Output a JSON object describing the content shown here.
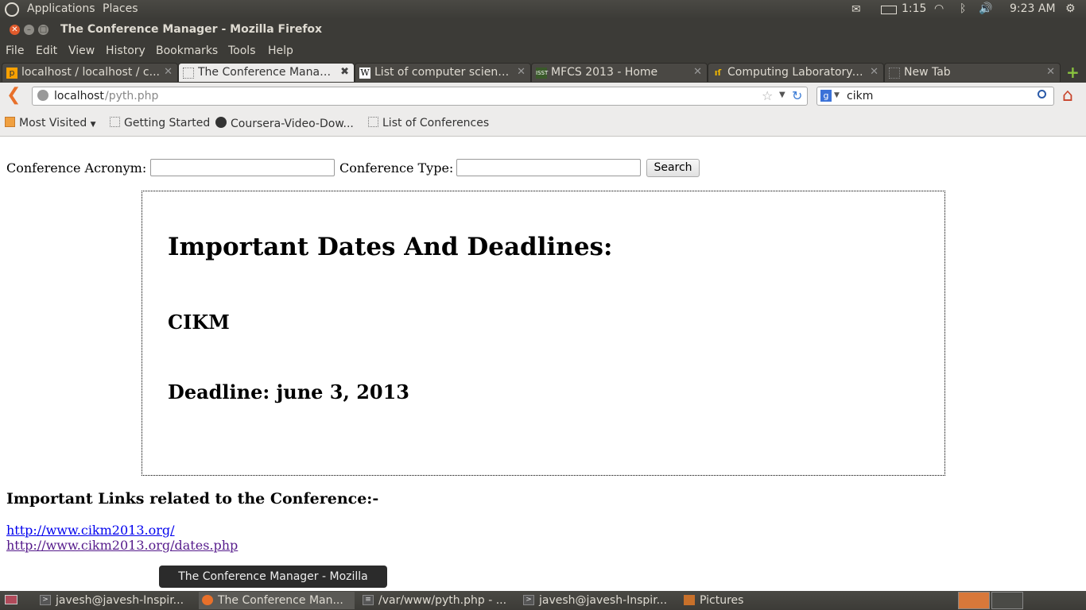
{
  "top_panel": {
    "menus": [
      "Applications",
      "Places"
    ],
    "battery": "1:15",
    "clock": "9:23 AM"
  },
  "window": {
    "title": "The Conference Manager - Mozilla Firefox"
  },
  "menu_bar": [
    "File",
    "Edit",
    "View",
    "History",
    "Bookmarks",
    "Tools",
    "Help"
  ],
  "tabs": [
    {
      "label": "localhost / localhost / c...",
      "icon": "pma-icon"
    },
    {
      "label": "The Conference Manager",
      "icon": "blank-page-icon",
      "active": true
    },
    {
      "label": "List of computer scienc...",
      "icon": "wikipedia-icon"
    },
    {
      "label": "MFCS 2013 - Home",
      "icon": "isst-icon"
    },
    {
      "label": "Computing Laboratory:...",
      "icon": "oxford-icon"
    },
    {
      "label": "New Tab",
      "icon": "blank-page-icon"
    }
  ],
  "nav": {
    "url_host": "localhost",
    "url_path": "/pyth.php",
    "search_query": "cikm"
  },
  "bookmarks": [
    "Most Visited",
    "Getting Started",
    "Coursera-Video-Dow...",
    "List of Conferences"
  ],
  "page": {
    "acronym_label": "Conference Acronym:",
    "type_label": "Conference Type:",
    "search_button": "Search",
    "dates_heading": "Important Dates And Deadlines:",
    "conference": "CIKM",
    "deadline": "Deadline: june 3, 2013",
    "links_heading": "Important Links related to the Conference:-",
    "links": [
      "http://www.cikm2013.org/",
      "http://www.cikm2013.org/dates.php"
    ],
    "link_colors": [
      "#0000ee",
      "#551a8b"
    ]
  },
  "tooltip": "The Conference Manager - Mozilla Firefox",
  "taskbar": [
    {
      "label": "javesh@javesh-Inspir...",
      "icon": "terminal-icon"
    },
    {
      "label": "The Conference Man...",
      "icon": "firefox-icon",
      "active": true
    },
    {
      "label": "/var/www/pyth.php - ...",
      "icon": "text-editor-icon"
    },
    {
      "label": "javesh@javesh-Inspir...",
      "icon": "terminal-icon"
    },
    {
      "label": "Pictures",
      "icon": "folder-icon"
    }
  ]
}
